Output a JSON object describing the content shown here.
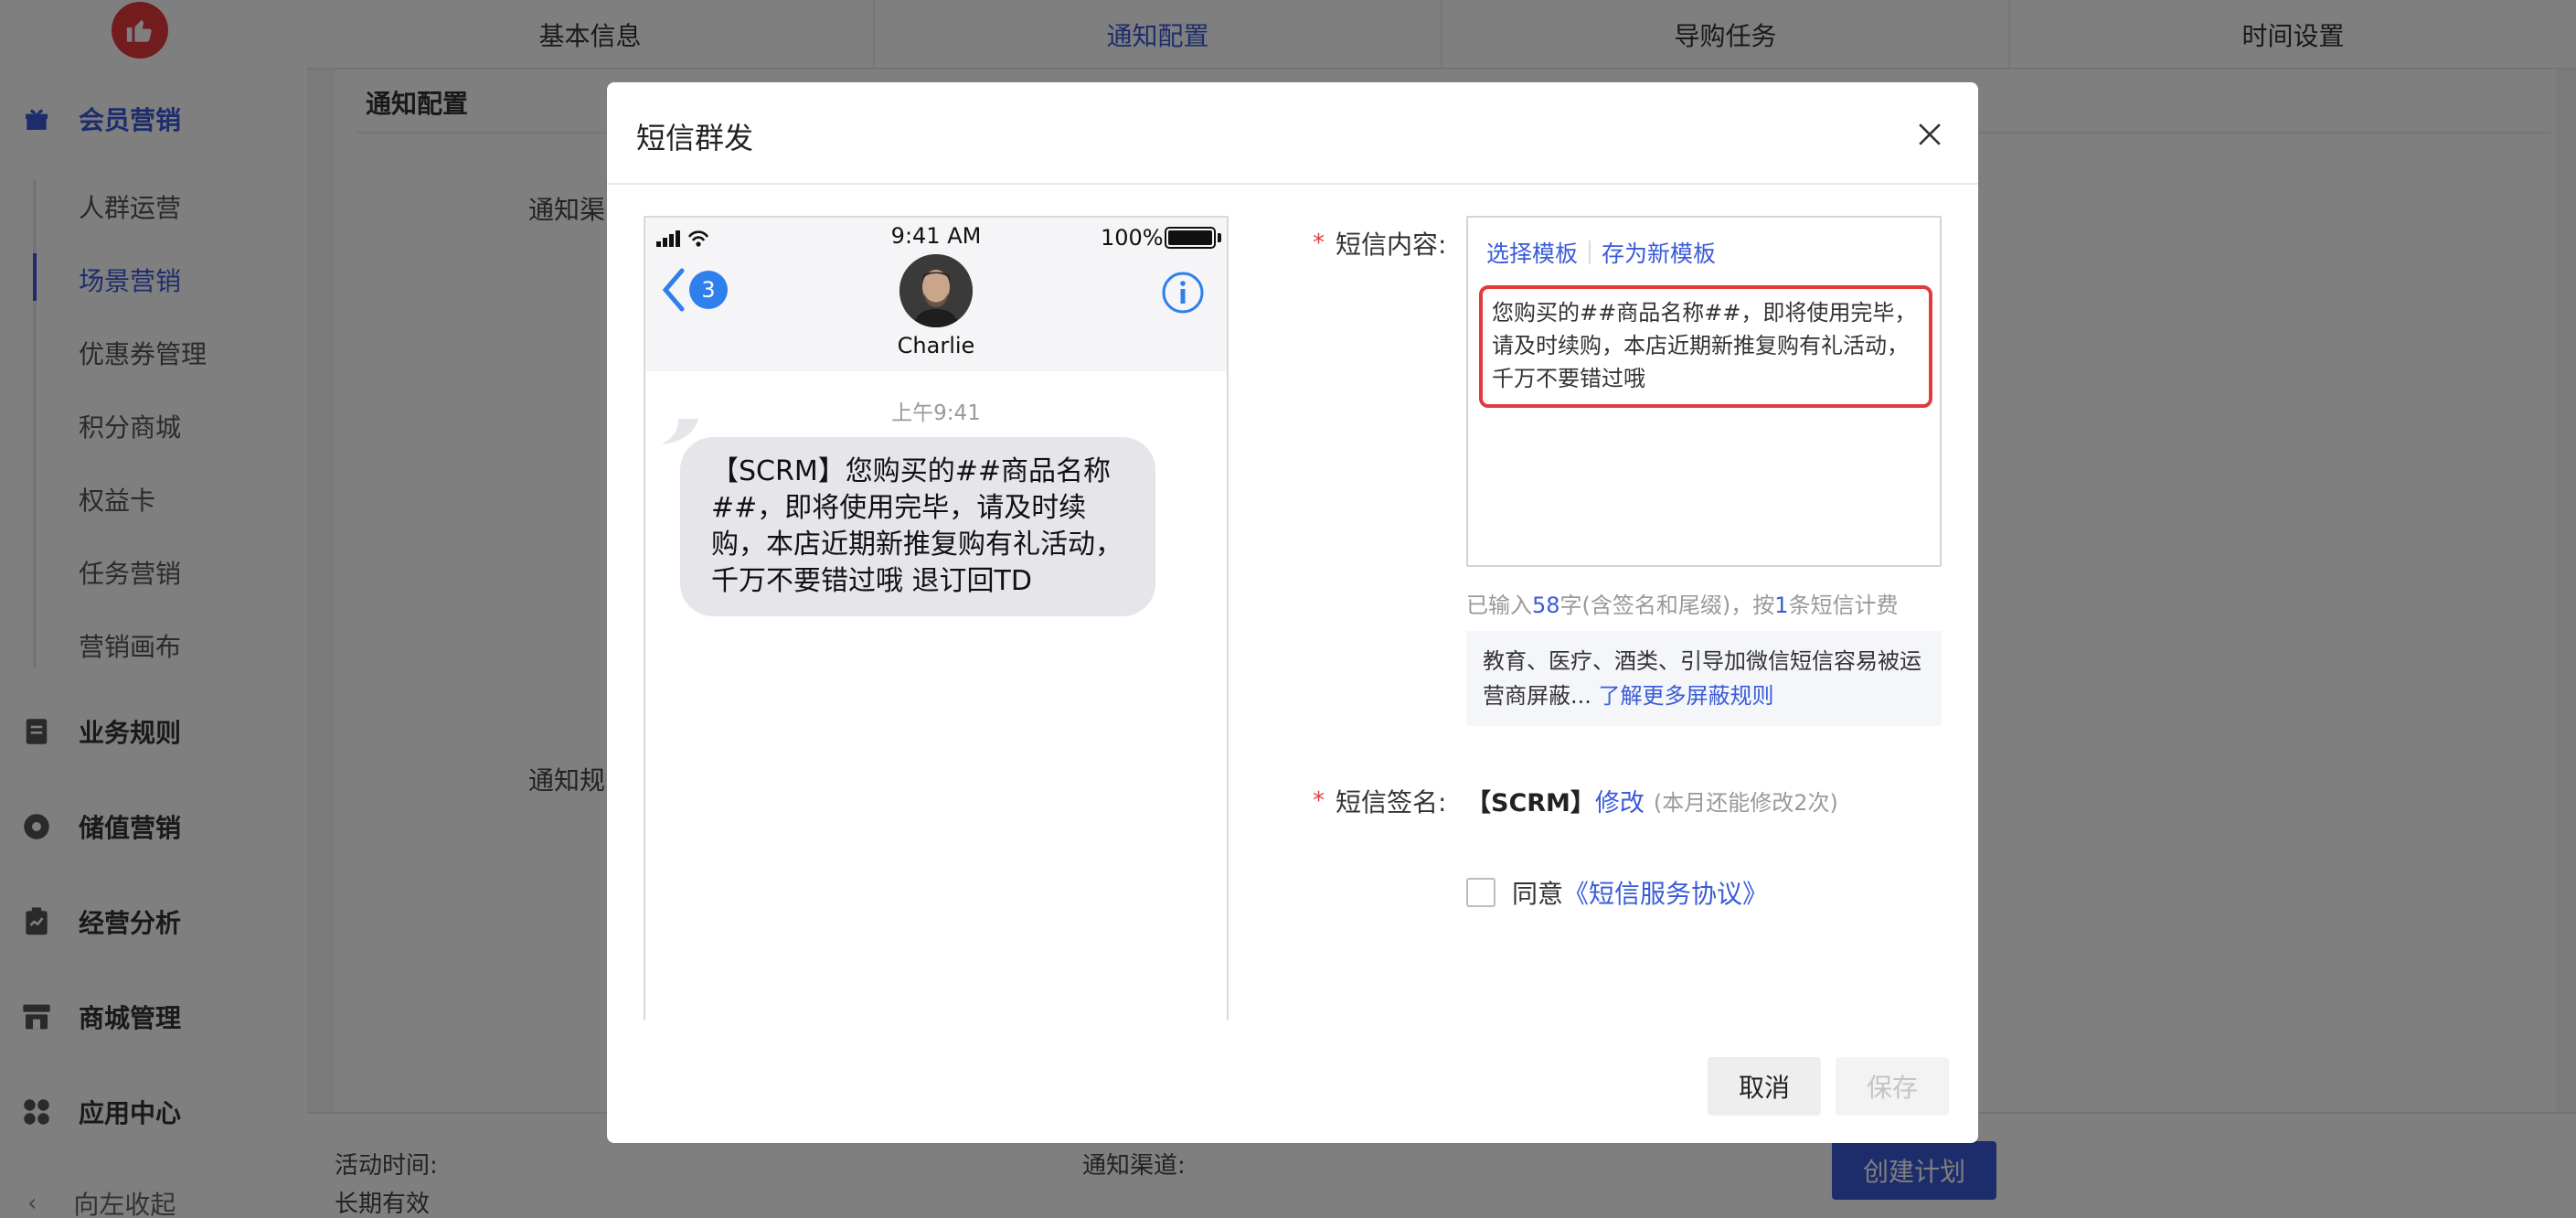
{
  "sidebar": {
    "groups": [
      {
        "label": "会员营销",
        "icon": "gift-icon"
      },
      {
        "label": "业务规则",
        "icon": "document-icon"
      },
      {
        "label": "储值营销",
        "icon": "coin-icon"
      },
      {
        "label": "经营分析",
        "icon": "clipboard-icon"
      },
      {
        "label": "商城管理",
        "icon": "store-icon"
      },
      {
        "label": "应用中心",
        "icon": "apps-icon"
      }
    ],
    "sub_items": [
      "人群运营",
      "场景营销",
      "优惠券管理",
      "积分商城",
      "权益卡",
      "任务营销",
      "营销画布"
    ],
    "active_sub": "场景营销",
    "collapse_label": "向左收起"
  },
  "tabs": [
    "基本信息",
    "通知配置",
    "导购任务",
    "时间设置"
  ],
  "active_tab": "通知配置",
  "content": {
    "title": "通知配置",
    "label_channel": "通知渠",
    "label_rule": "通知规"
  },
  "bottom_bar": {
    "activity_time_label": "活动时间:",
    "activity_time_value": "长期有效",
    "channel_label": "通知渠道:",
    "create_button": "创建计划"
  },
  "modal": {
    "title": "短信群发",
    "phone": {
      "time": "9:41 AM",
      "battery": "100%",
      "back_badge": "3",
      "contact": "Charlie",
      "message_time": "上午9:41",
      "message": "【SCRM】您购买的##商品名称##，即将使用完毕，请及时续购，本店近期新推复购有礼活动，千万不要错过哦 退订回TD"
    },
    "form": {
      "content_label": "短信内容:",
      "select_template": "选择模板",
      "save_template": "存为新模板",
      "content_value": "您购买的##商品名称##，即将使用完毕，请及时续购，本店近期新推复购有礼活动，千万不要错过哦",
      "count_prefix": "已输入",
      "count_chars": "58",
      "count_middle": "字(含签名和尾缀)，按",
      "count_msgs": "1",
      "count_suffix": "条短信计费",
      "notice_text": "教育、医疗、酒类、引导加微信短信容易被运营商屏蔽...",
      "notice_link": "了解更多屏蔽规则",
      "sign_label": "短信签名:",
      "sign_value": "【SCRM】",
      "sign_edit": "修改",
      "sign_hint": "(本月还能修改2次)",
      "agree_prefix": "同意",
      "agree_link": "《短信服务协议》"
    },
    "buttons": {
      "cancel": "取消",
      "save": "保存"
    }
  },
  "colors": {
    "accent": "#3a5bd9",
    "danger": "#e23b3b",
    "brand": "#e4393c"
  }
}
